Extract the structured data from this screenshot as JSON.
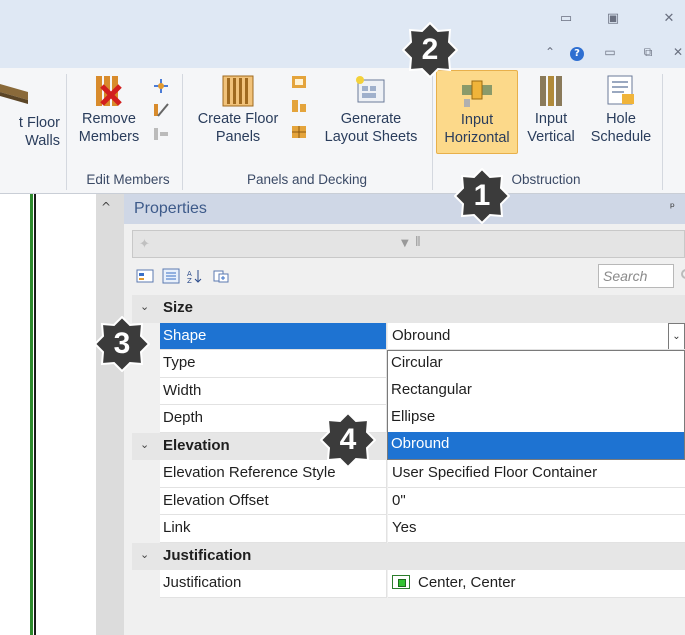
{
  "window": {
    "minimize_glyph": "▭",
    "restore_glyph": "▣",
    "close_glyph": "✕",
    "quick_up_glyph": "⌃",
    "quick_help_glyph": "?",
    "quick_min_glyph": "▭",
    "quick_restore_glyph": "⧉",
    "quick_close_glyph": "✕"
  },
  "ribbon": {
    "partial_button": {
      "line1": "t Floor",
      "line2": "Walls"
    },
    "remove_members": {
      "line1": "Remove",
      "line2": "Members"
    },
    "create_floor_panels": {
      "line1": "Create Floor",
      "line2": "Panels"
    },
    "generate_layout_sheets": {
      "line1": "Generate",
      "line2": "Layout Sheets"
    },
    "input_horizontal": {
      "line1": "Input",
      "line2": "Horizontal"
    },
    "input_vertical": {
      "line1": "Input",
      "line2": "Vertical"
    },
    "hole_schedule": {
      "line1": "Hole",
      "line2": "Schedule"
    },
    "groups": {
      "edit_members": "Edit Members",
      "panels_and_decking": "Panels and Decking",
      "obstruction": "Obstruction"
    }
  },
  "properties": {
    "title": "Properties",
    "pin_glyph": "ᵖ",
    "search_placeholder": "Search",
    "categories": {
      "size": "Size",
      "elevation": "Elevation",
      "justification": "Justification"
    },
    "rows": {
      "shape": {
        "label": "Shape",
        "value": "Obround"
      },
      "type": {
        "label": "Type",
        "value": ""
      },
      "width": {
        "label": "Width",
        "value": ""
      },
      "depth": {
        "label": "Depth",
        "value": ""
      },
      "elevation_reference_style": {
        "label": "Elevation Reference Style",
        "value": "User Specified Floor Container"
      },
      "elevation_offset": {
        "label": "Elevation Offset",
        "value": "0\""
      },
      "link": {
        "label": "Link",
        "value": "Yes"
      },
      "justification": {
        "label": "Justification",
        "value": "Center, Center"
      }
    },
    "shape_options": [
      "Circular",
      "Rectangular",
      "Ellipse",
      "Obround"
    ],
    "selected_option_index": 3
  },
  "callouts": {
    "one": "1",
    "two": "2",
    "three": "3",
    "four": "4"
  },
  "colors": {
    "accent_selection": "#1e73d2",
    "ribbon_active": "#fcd98a",
    "callout_fill": "#3b3b3b"
  }
}
